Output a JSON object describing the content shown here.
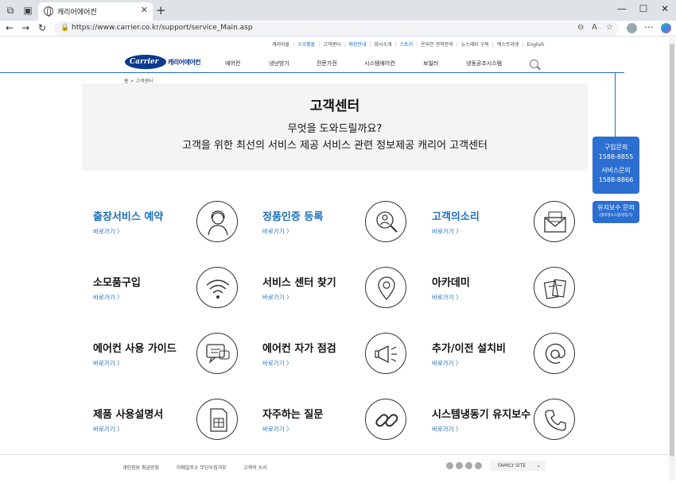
{
  "browser": {
    "tab_title": "캐리어에어컨",
    "url": "https://www.carrier.co.kr/support/service_Main.asp",
    "new_tab": "+",
    "close": "✕",
    "minimize": "—",
    "maximize": "☐",
    "window_close": "✕",
    "back": "←",
    "forward": "→",
    "refresh": "↻"
  },
  "util_nav": [
    "캐리어몰",
    "소모품몰",
    "고객센터",
    "매장안내",
    "회사소개",
    "스토리",
    "온라인 견적문의",
    "뉴스레터 구독",
    "엑스트라넷",
    "English"
  ],
  "util_nav_blue": [
    1,
    3,
    5
  ],
  "logo": {
    "brand": "Carrier",
    "kr": "캐리어에어컨"
  },
  "gnb": [
    "에어컨",
    "냉난방기",
    "전문가전",
    "시스템에어컨",
    "보일러",
    "냉동공조시스템"
  ],
  "breadcrumb": "홈 > 고객센터",
  "hero": {
    "title": "고객센터",
    "line1": "무엇을 도와드릴까요?",
    "line2": "고객을 위한 최선의 서비스 제공 서비스 관련 정보제공 캐리어 고객센터"
  },
  "quick": {
    "purchase_label": "구입문의",
    "purchase_phone": "1588-8855",
    "service_label": "서비스문의",
    "service_phone": "1588-8866",
    "maint_label": "유지보수 문의",
    "maint_sub": "(중대형시스템/냉동기)"
  },
  "go_label": "바로가기 〉",
  "cards": [
    {
      "title": "출장서비스 예약",
      "icon": "agent-icon",
      "blue": true
    },
    {
      "title": "정품인증 등록",
      "icon": "search-person-icon",
      "blue": true
    },
    {
      "title": "고객의소리",
      "icon": "envelope-icon",
      "blue": true
    },
    {
      "title": "소모품구입",
      "icon": "wifi-icon",
      "blue": false
    },
    {
      "title": "서비스 센터 찾기",
      "icon": "location-pin-icon",
      "blue": false
    },
    {
      "title": "아카데미",
      "icon": "books-icon",
      "blue": false
    },
    {
      "title": "에어컨 사용 가이드",
      "icon": "chat-icon",
      "blue": false
    },
    {
      "title": "에어컨 자가 점검",
      "icon": "megaphone-icon",
      "blue": false
    },
    {
      "title": "추가/이전 설치비",
      "icon": "at-sign-icon",
      "blue": false
    },
    {
      "title": "제품 사용설명서",
      "icon": "sim-card-icon",
      "blue": false
    },
    {
      "title": "자주하는 질문",
      "icon": "link-icon",
      "blue": false
    },
    {
      "title": "시스템냉동기 유지보수",
      "icon": "phone-icon",
      "blue": false
    }
  ],
  "footer": {
    "links": [
      "개인정보 취급방침",
      "이메일주소 무단수집거부",
      "고객의 소리"
    ],
    "family_site": "FAMILY SITE"
  },
  "colors": {
    "brand_blue": "#1d6fb8",
    "logo_navy": "#0a3b8f",
    "quick_blue": "#2c6fd1"
  }
}
